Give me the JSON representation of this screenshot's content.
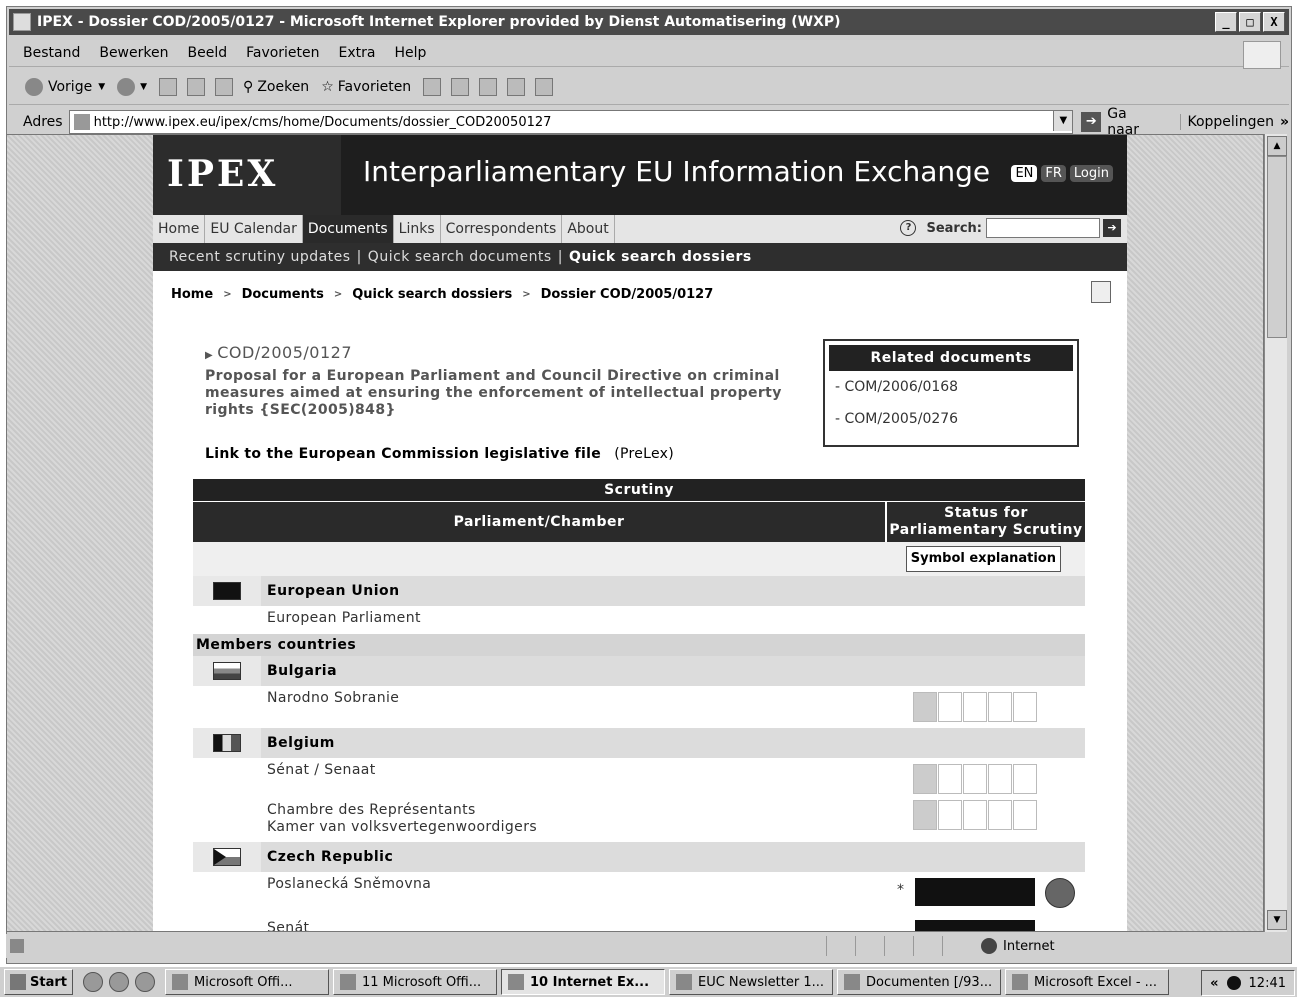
{
  "window": {
    "title": "IPEX - Dossier COD/2005/0127 - Microsoft Internet Explorer provided by Dienst Automatisering (WXP)",
    "controls": [
      "_",
      "□",
      "X"
    ]
  },
  "menu": [
    "Bestand",
    "Bewerken",
    "Beeld",
    "Favorieten",
    "Extra",
    "Help"
  ],
  "toolbar": {
    "back": "Vorige",
    "search": "Zoeken",
    "favorites": "Favorieten"
  },
  "address": {
    "label": "Adres",
    "url": "http://www.ipex.eu/ipex/cms/home/Documents/dossier_COD20050127",
    "go": "Ga naar",
    "links": "Koppelingen"
  },
  "site": {
    "logo": "IPEX",
    "title": "Interparliamentary EU Information Exchange",
    "langs": [
      "EN",
      "FR",
      "Login"
    ],
    "nav": [
      "Home",
      "EU Calendar",
      "Documents",
      "Links",
      "Correspondents",
      "About"
    ],
    "search_label": "Search:",
    "subnav": [
      "Recent scrutiny updates",
      "Quick search documents",
      "Quick search dossiers"
    ]
  },
  "breadcrumb": [
    "Home",
    "Documents",
    "Quick search dossiers",
    "Dossier COD/2005/0127"
  ],
  "dossier": {
    "id": "COD/2005/0127",
    "description": "Proposal for a European Parliament and Council Directive on criminal measures aimed at ensuring the enforcement of intellectual property rights {SEC(2005)848}",
    "link_label": "Link to the European Commission legislative file",
    "link_target": "(PreLex)"
  },
  "related": {
    "title": "Related documents",
    "items": [
      "- COM/2006/0168",
      "- COM/2005/0276"
    ]
  },
  "scrutiny": {
    "title": "Scrutiny",
    "col_chamber": "Parliament/Chamber",
    "col_status": "Status for Parliamentary Scrutiny",
    "symbol_btn": "Symbol explanation",
    "eu": {
      "name": "European Union",
      "chamber": "European Parliament"
    },
    "members_label": "Members countries",
    "countries": [
      {
        "name": "Bulgaria",
        "chambers": [
          "Narodno Sobranie"
        ]
      },
      {
        "name": "Belgium",
        "chambers": [
          "Sénat / Senaat",
          "Chambre des Représentants",
          "Kamer van volksvertegenwoordigers"
        ]
      },
      {
        "name": "Czech Republic",
        "chambers": [
          "Poslanecká Sněmovna",
          "Senát"
        ]
      }
    ],
    "star": "*"
  },
  "status": {
    "zone": "Internet"
  },
  "taskbar": {
    "start": "Start",
    "buttons": [
      "Microsoft Offi...",
      "11 Microsoft Offi...",
      "10 Internet Ex...",
      "EUC Newsletter 1...",
      "Documenten [/93...",
      "Microsoft Excel - ..."
    ],
    "clock": "12:41",
    "tray_arrow": "«"
  }
}
